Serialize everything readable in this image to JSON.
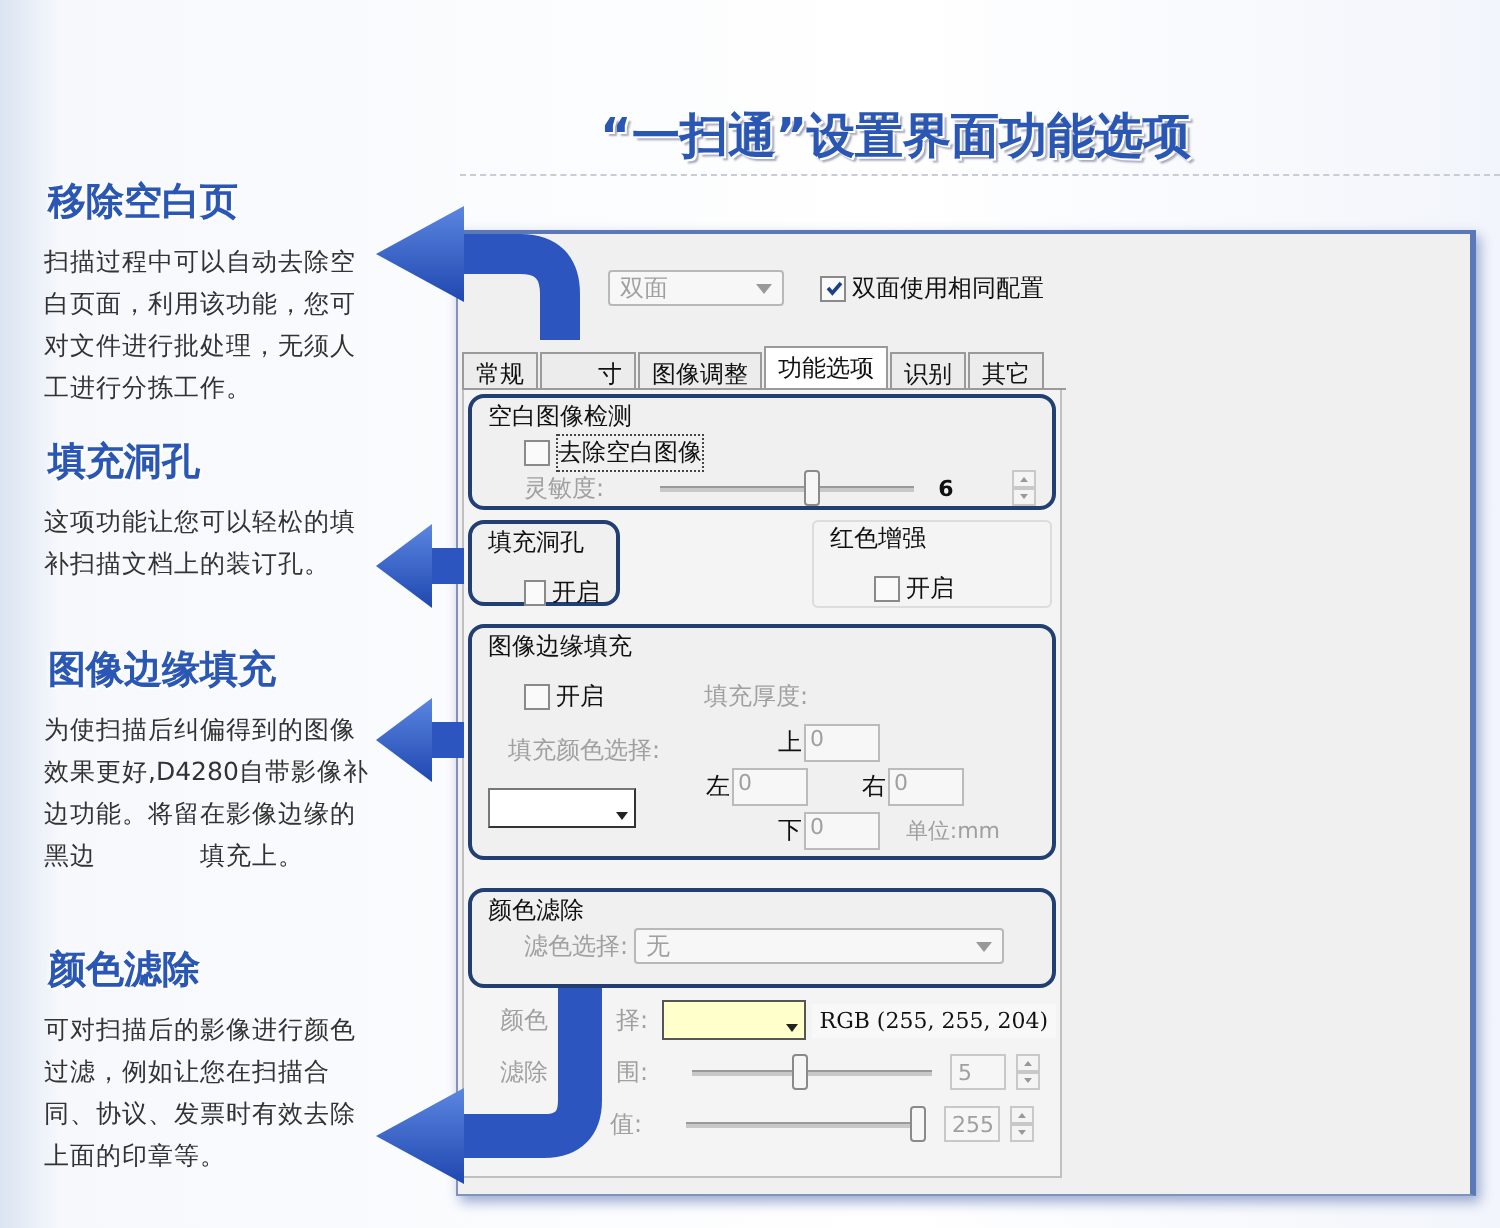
{
  "title": "“一扫通”设置界面功能选项",
  "features": [
    {
      "heading": "移除空白页",
      "text": "扫描过程中可以自动去除空白页面，利用该功能，您可对文件进行批处理，无须人工进行分拣工作。"
    },
    {
      "heading": "填充洞孔",
      "text": "这项功能让您可以轻松的填补扫描文档上的装订孔。"
    },
    {
      "heading": "图像边缘填充",
      "text": "为使扫描后纠偏得到的图像效果更好,D4280自带影像补边功能。将留在影像边缘的黑边　　　　填充上。"
    },
    {
      "heading": "颜色滤除",
      "text": "可对扫描后的影像进行颜色过滤，例如让您在扫描合同、协议、发票时有效去除上面的印章等。"
    }
  ],
  "dialog": {
    "side_select": {
      "value": "双面",
      "disabled": true
    },
    "same_config": {
      "label": "双面使用相同配置",
      "checked": true
    },
    "tabs": [
      {
        "label": "常规",
        "selected": false
      },
      {
        "label": "寸",
        "selected": false
      },
      {
        "label": "图像调整",
        "selected": false
      },
      {
        "label": "功能选项",
        "selected": true
      },
      {
        "label": "识别",
        "selected": false
      },
      {
        "label": "其它",
        "selected": false
      }
    ],
    "blank_detect": {
      "title": "空白图像检测",
      "remove": {
        "label": "去除空白图像",
        "checked": false
      },
      "sensitivity": {
        "label": "灵敏度:",
        "level": 0.6,
        "value": "6",
        "disabled": true
      }
    },
    "fill_holes": {
      "title": "填充洞孔",
      "enable": {
        "label": "开启",
        "checked": false
      }
    },
    "red_enhance": {
      "title": "红色增强",
      "enable": {
        "label": "开启",
        "checked": false
      }
    },
    "edge_fill": {
      "title": "图像边缘填充",
      "enable": {
        "label": "开启",
        "checked": false
      },
      "thickness_label": "填充厚度:",
      "color_label": "填充颜色选择:",
      "top": {
        "label": "上",
        "value": "0"
      },
      "left": {
        "label": "左",
        "value": "0"
      },
      "right": {
        "label": "右",
        "value": "0"
      },
      "bottom": {
        "label": "下",
        "value": "0"
      },
      "unit": "单位:mm",
      "disabled": true
    },
    "color_filter": {
      "title": "颜色滤除",
      "filter_label": "滤色选择:",
      "filter_value": "无",
      "color_label": [
        "颜色",
        "择:"
      ],
      "color": "#ffffcc",
      "rgb": "RGB (255, 255, 204)",
      "range_label": [
        "滤除",
        "围:"
      ],
      "range": {
        "level": 0.45,
        "value": "5"
      },
      "threshold_label": "值:",
      "threshold": {
        "level": 0.97,
        "value": "255"
      },
      "disabled": true
    }
  }
}
